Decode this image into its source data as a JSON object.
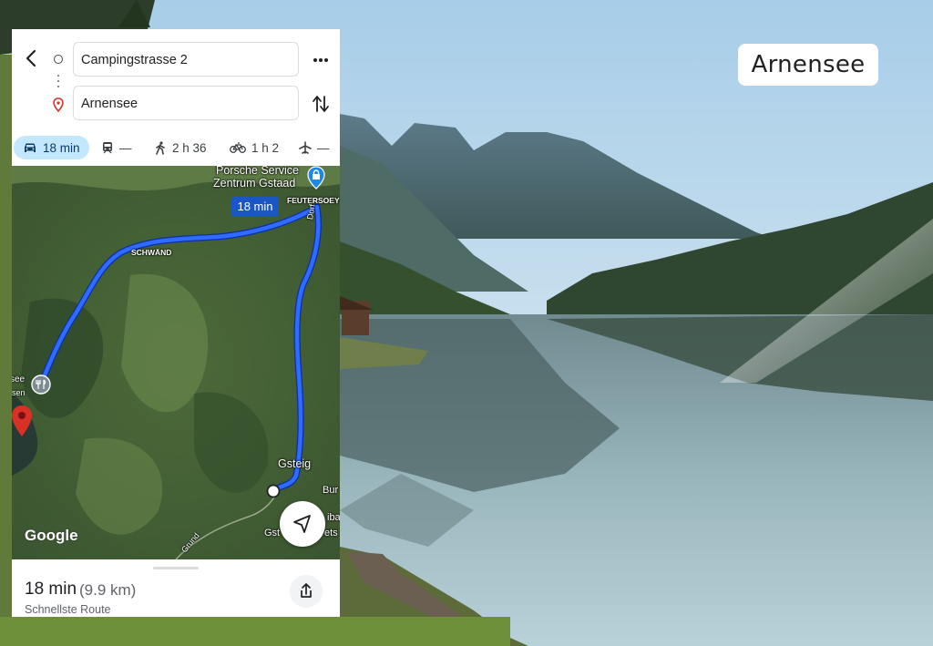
{
  "overlay": {
    "title": "Arnensee"
  },
  "route": {
    "origin": "Campingstrasse 2",
    "destination": "Arnensee"
  },
  "modes": [
    {
      "icon": "car-icon",
      "label": "18 min",
      "active": true
    },
    {
      "icon": "train-icon",
      "label": "—"
    },
    {
      "icon": "walk-icon",
      "label": "2 h 36"
    },
    {
      "icon": "bike-icon",
      "label": "1 h 2"
    },
    {
      "icon": "plane-icon",
      "label": "—"
    }
  ],
  "map": {
    "poi_name_line1": "Porsche Service",
    "poi_name_line2": "Zentrum Gstaad",
    "route_time_chip": "18 min",
    "labels": {
      "feutersoey": "FEUTERSOEY",
      "schwand": "SCHWÄND",
      "dorf": "Dorf",
      "gsteig": "Gsteig",
      "gsteig_lower": "Gst",
      "bur": "Bur",
      "iba": "iba",
      "ets": "ets",
      "grund": "Grund",
      "see": "see",
      "sen": "sen"
    },
    "logo": "Google"
  },
  "summary": {
    "time": "18 min",
    "distance": "(9.9 km)",
    "subtitle": "Schnellste Route"
  },
  "colors": {
    "route": "#1a56f0",
    "active_mode_bg": "#c2e7ff",
    "pin_red": "#d93025"
  }
}
